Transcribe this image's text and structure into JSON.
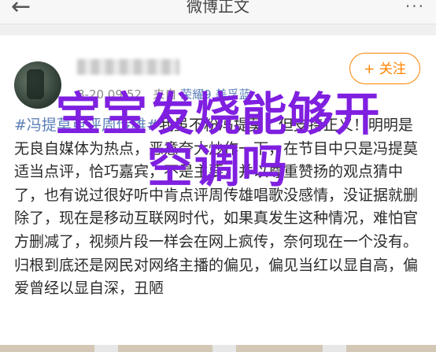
{
  "header": {
    "title": "微博正文",
    "back_glyph": "←",
    "more_glyph": "···"
  },
  "post": {
    "author_name": "",
    "time": "8-20 09:52",
    "source_prefix": "来自",
    "device": "荣耀9 美孚蓝",
    "follow_label": "+ 关注",
    "hashtag": "#冯提莫点评周传雄#",
    "text": "我虽不粉冯提莫，但支持正义！明明是无良自媒体为热点，恶意夸大炒作一下，在节目中只是冯提莫适当点评，恰巧嘉宾，不是主要，并以尊重赞扬的观点猜中了，也有说过很好听中肯点评周传雄唱歌没感情，没证据就删除了，现在是移动互联网时代，如果真发生这种情况，难怕官方删减了，视频片段一样会在网上疯传，奈何现在一个没有。归根到底还是网民对网络主播的偏见，偏见当红以显自高，偏爱曾经以显自深，丑陋"
  },
  "overlay": {
    "line1": "宝宝发烧能够开",
    "line2": "空调吗"
  },
  "colors": {
    "accent": "#ff8200",
    "link": "#5b7fb8",
    "overlay": "#7f1fe0"
  }
}
